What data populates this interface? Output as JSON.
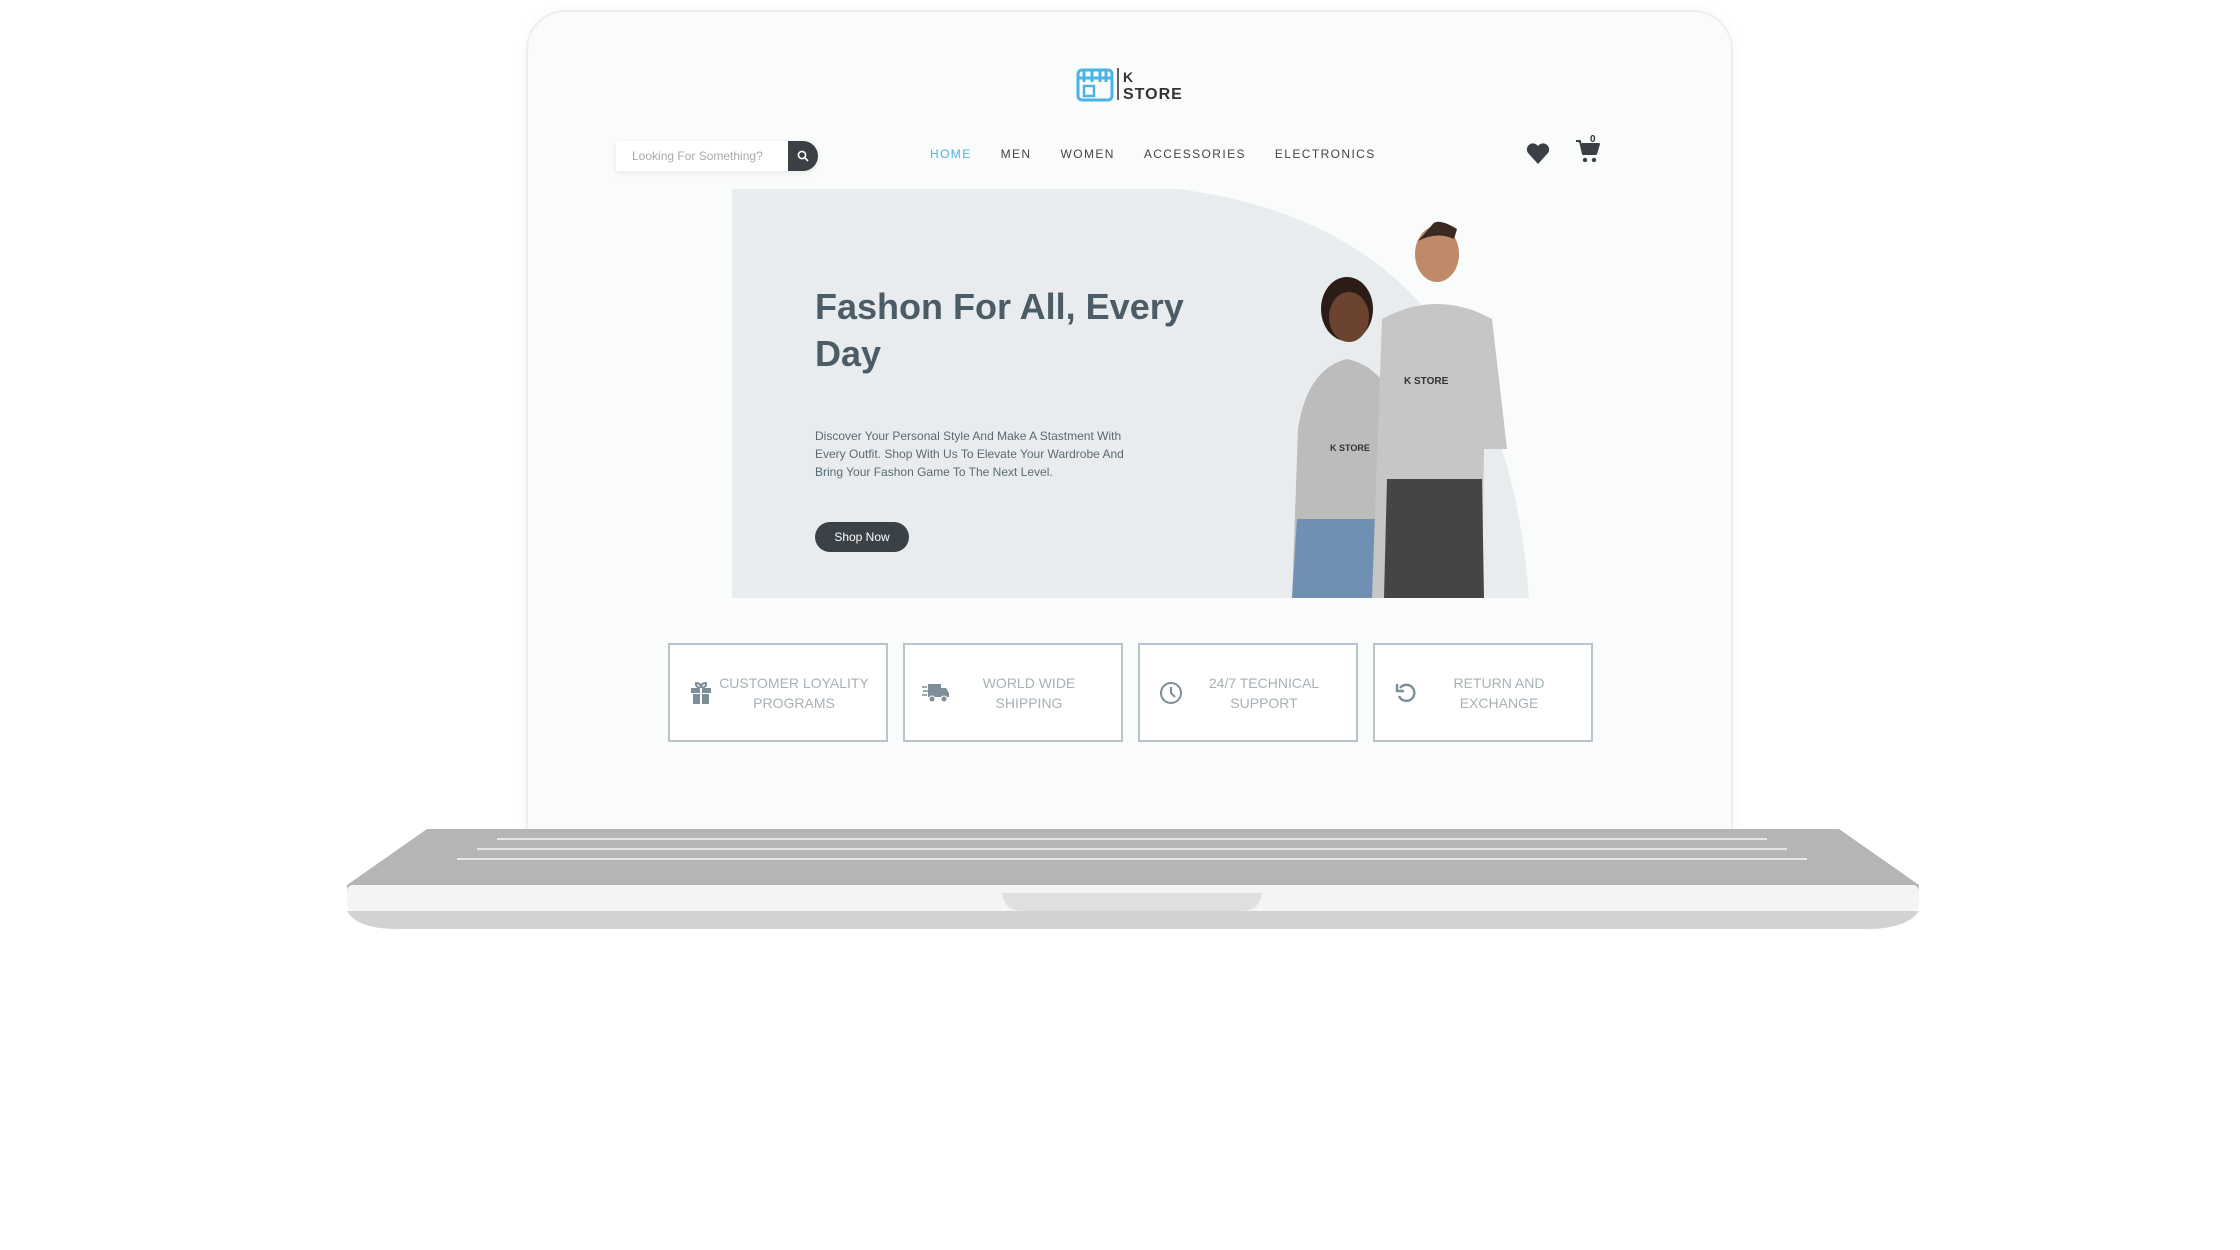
{
  "brand": {
    "logo_text": "K STORE",
    "logo_color": "#4ab3e8"
  },
  "search": {
    "placeholder": "Looking For Something?",
    "icon": "search-icon"
  },
  "nav": {
    "items": [
      {
        "label": "HOME",
        "active": true
      },
      {
        "label": "MEN"
      },
      {
        "label": "WOMEN"
      },
      {
        "label": "ACCESSORIES"
      },
      {
        "label": "ELECTRONICS"
      }
    ],
    "active_color": "#4ab3e8"
  },
  "header_icons": {
    "wishlist": "heart-icon",
    "cart": "cart-icon",
    "cart_count": "0"
  },
  "hero": {
    "title": "Fashon For All, Every Day",
    "description": "Discover Your Personal Style And Make A Stastment With Every Outfit. Shop With Us To Elevate Your Wardrobe And Bring Your Fashon Game To The Next Level.",
    "cta": "Shop Now"
  },
  "features": [
    {
      "label": "CUSTOMER LOYALITY PROGRAMS",
      "icon": "gift-icon"
    },
    {
      "label": "WORLD WIDE SHIPPING",
      "icon": "truck-icon"
    },
    {
      "label": "24/7 TECHNICAL SUPPORT",
      "icon": "clock-icon"
    },
    {
      "label": "RETURN AND EXCHANGE",
      "icon": "undo-icon"
    }
  ]
}
